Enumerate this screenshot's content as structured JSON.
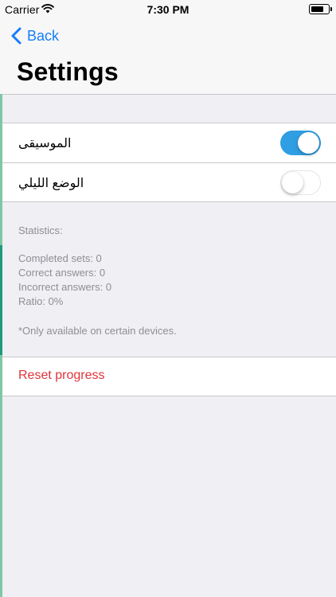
{
  "status_bar": {
    "carrier": "Carrier",
    "time": "7:30 PM"
  },
  "nav": {
    "back_label": "Back",
    "title": "Settings"
  },
  "settings": [
    {
      "label": "الموسيقى",
      "enabled": true
    },
    {
      "label": "الوضع الليلي",
      "enabled": false
    }
  ],
  "statistics": {
    "heading": "Statistics:",
    "lines": [
      "Completed sets: 0",
      "Correct answers: 0",
      "Incorrect answers: 0",
      "Ratio: 0%"
    ],
    "note": "*Only available on certain devices."
  },
  "reset_label": "Reset progress",
  "colors": {
    "accent": "#157efb",
    "switch_on": "#2f9ee2",
    "destructive": "#e0343a",
    "secondary_text": "#8e8e93",
    "background": "#efeff4"
  }
}
